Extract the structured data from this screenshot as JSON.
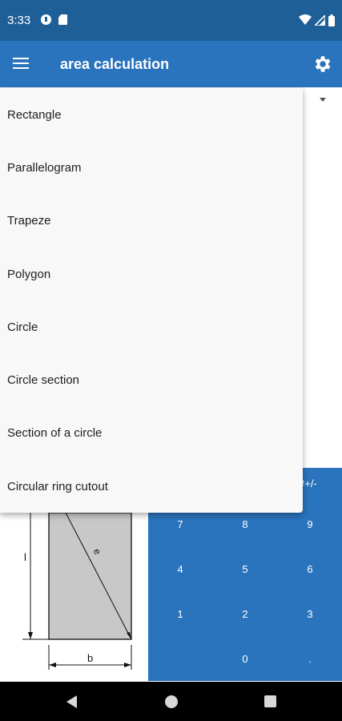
{
  "status_bar": {
    "time": "3:33",
    "icons": [
      "notification-icon",
      "sim-card-icon",
      "wifi-icon",
      "signal-icon",
      "battery-icon"
    ]
  },
  "app_bar": {
    "title": "area calculation",
    "menu_icon": "hamburger-menu-icon",
    "settings_icon": "gear-icon"
  },
  "shape_menu": {
    "items": [
      "Rectangle",
      "Parallelogram",
      "Trapeze",
      "Polygon",
      "Circle",
      "Circle section",
      "Section of a circle",
      "Circular ring cutout"
    ]
  },
  "diagram": {
    "side_l": "l",
    "side_b": "b",
    "diagonal_e": "e"
  },
  "keypad": {
    "plus_minus": "#+/-",
    "rows": [
      [
        "7",
        "8",
        "9"
      ],
      [
        "4",
        "5",
        "6"
      ],
      [
        "1",
        "2",
        "3"
      ],
      [
        "",
        "0",
        "."
      ]
    ]
  },
  "colors": {
    "status_bar": "#1f5f98",
    "app_bar": "#2a74bd",
    "keypad": "#2a74bd",
    "diagram_fill": "#c8c8c8"
  },
  "nav_bar": {
    "icons": [
      "back-icon",
      "home-icon",
      "recents-icon"
    ]
  }
}
